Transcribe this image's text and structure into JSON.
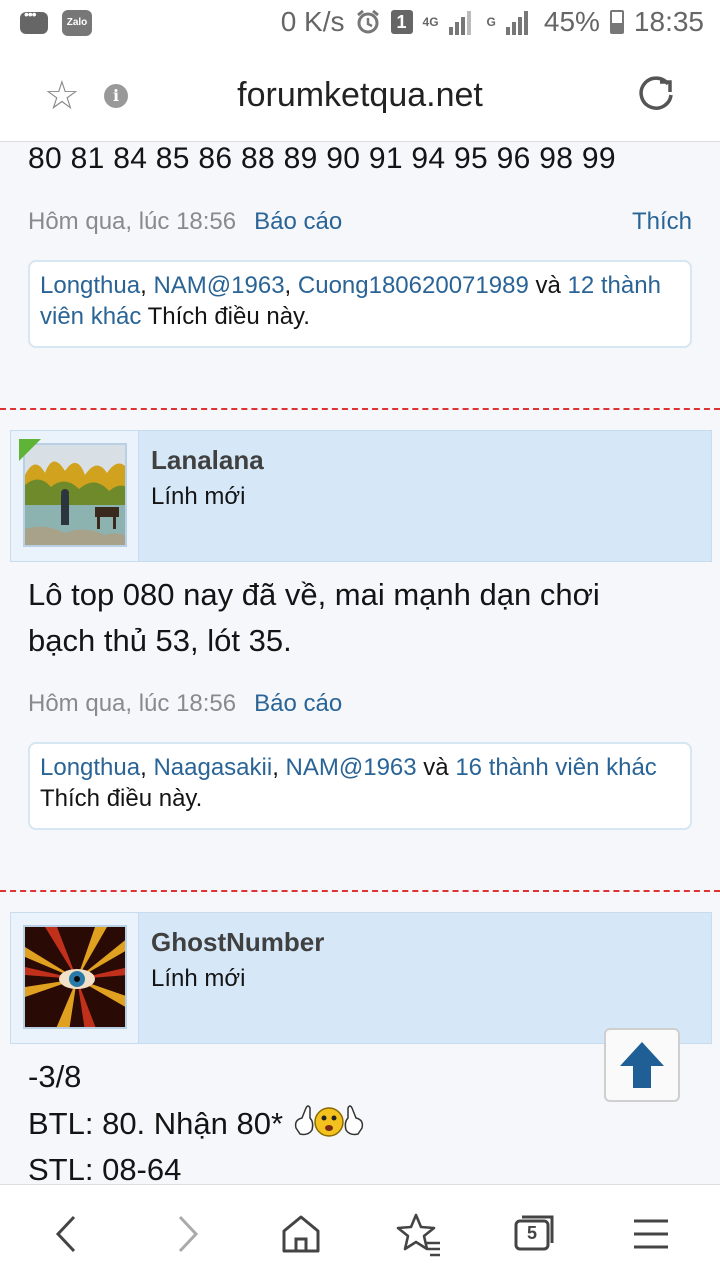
{
  "status_bar": {
    "net_speed": "0 K/s",
    "sim_badge": "1",
    "net_4g": "4G",
    "net_g": "G",
    "battery": "45%",
    "time": "18:35",
    "zalo_label": "Zalo"
  },
  "browser": {
    "url": "forumketqua.net",
    "tab_count": "5"
  },
  "post_prev": {
    "numbers": "80 81 84 85 86 88 89 90 91 94 95 96 98 99",
    "timestamp": "Hôm qua, lúc 18:56",
    "report": "Báo cáo",
    "like": "Thích",
    "likers": [
      "Longthua",
      "NAM@1963",
      "Cuong180620071989"
    ],
    "and_word": "và",
    "others": "12 thành viên khác",
    "likes_suffix": "Thích điều này."
  },
  "post_lanalana": {
    "username": "Lanalana",
    "user_title": "Lính mới",
    "text_line1": "Lô top 080 nay đã về, mai mạnh dạn chơi",
    "text_line2": "bạch thủ 53, lót 35.",
    "timestamp": "Hôm qua, lúc 18:56",
    "report": "Báo cáo",
    "likers": [
      "Longthua",
      "Naagasakii",
      "NAM@1963"
    ],
    "and_word": "và",
    "others": "16 thành viên khác",
    "likes_suffix": "Thích điều này."
  },
  "post_ghost": {
    "username": "GhostNumber",
    "user_title": "Lính mới",
    "line1": "-3/8",
    "line2": "BTL: 80. Nhận 80*",
    "line3": "STL: 08-64"
  }
}
